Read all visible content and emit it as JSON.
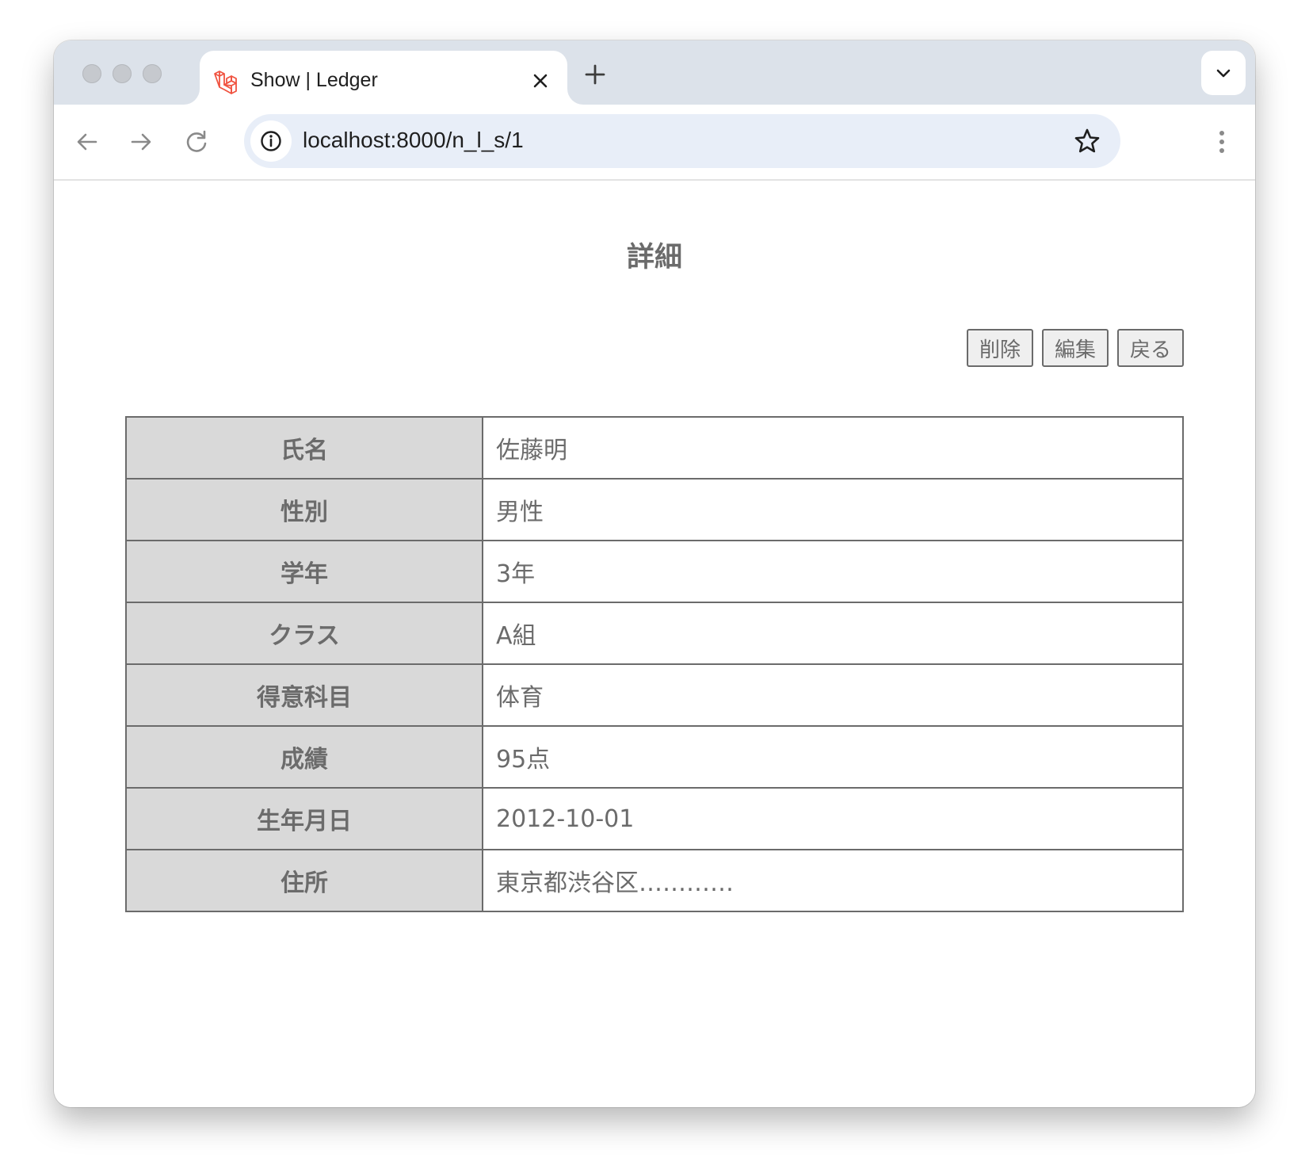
{
  "browser": {
    "tab_title": "Show | Ledger",
    "url": "localhost:8000/n_l_s/1",
    "favicon": "laravel-logo"
  },
  "page": {
    "title": "詳細",
    "buttons": {
      "delete": "削除",
      "edit": "編集",
      "back": "戻る"
    },
    "rows": [
      {
        "label": "氏名",
        "value": "佐藤明"
      },
      {
        "label": "性別",
        "value": "男性"
      },
      {
        "label": "学年",
        "value": "3年"
      },
      {
        "label": "クラス",
        "value": "A組"
      },
      {
        "label": "得意科目",
        "value": "体育"
      },
      {
        "label": "成績",
        "value": "95点"
      },
      {
        "label": "生年月日",
        "value": "2012-10-01"
      },
      {
        "label": "住所",
        "value": "東京都渋谷区…………"
      }
    ]
  },
  "colors": {
    "tabbar": "#dce2ea",
    "omnibox": "#e8eef8",
    "text_gray": "#6b6b6b",
    "header_cell": "#d9d9d9",
    "favicon_red": "#f05340"
  }
}
